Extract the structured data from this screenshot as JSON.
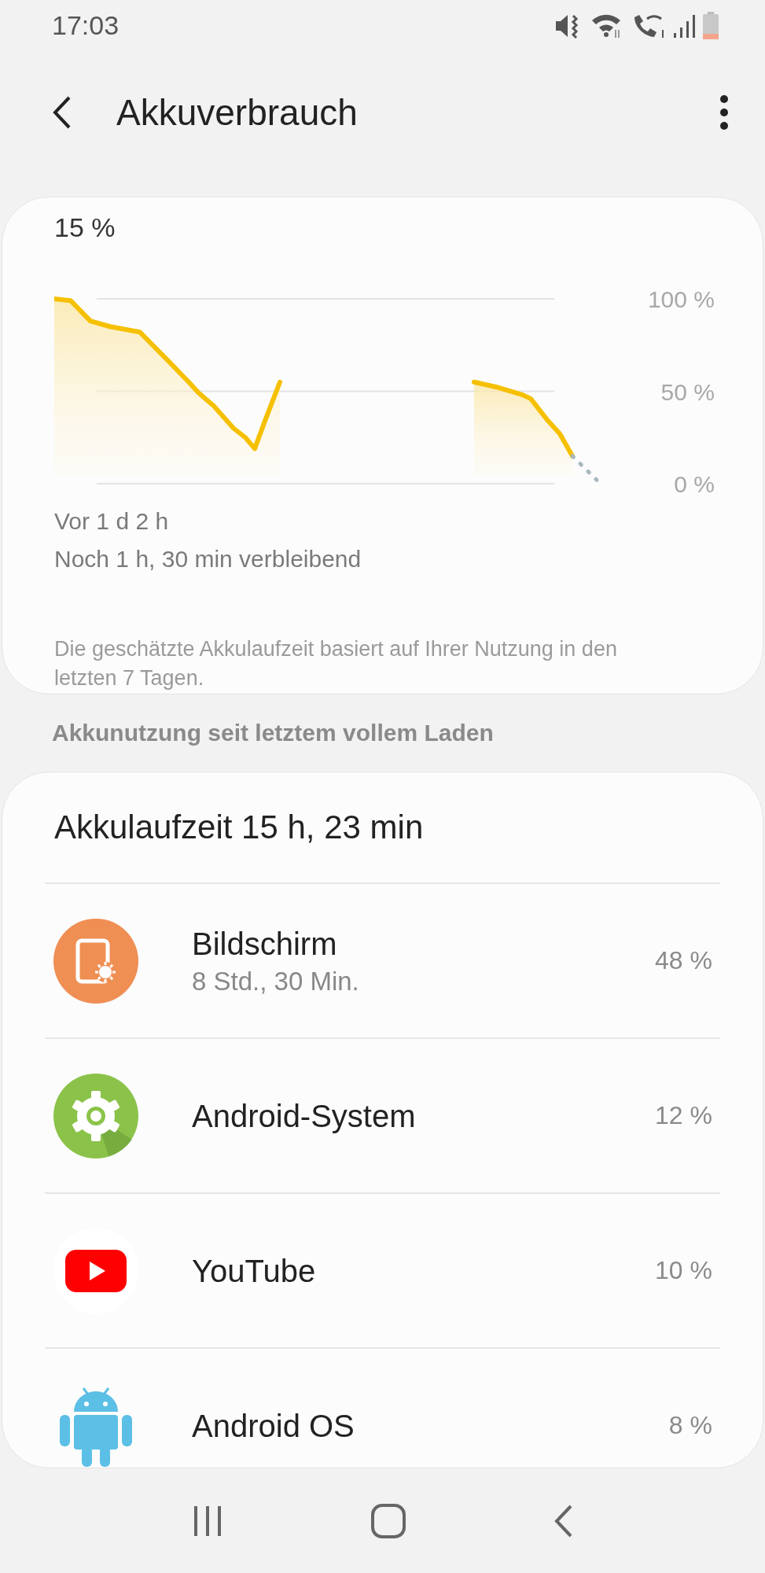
{
  "status_bar": {
    "time": "17:03"
  },
  "header": {
    "title": "Akkuverbrauch"
  },
  "battery_card": {
    "level_text": "15 %",
    "axis_labels": [
      "100 %",
      "50 %",
      "0 %"
    ],
    "start_label": "Vor 1 d 2 h",
    "remaining": "Noch 1 h, 30 min verbleibend",
    "note": "Die geschätzte Akkulaufzeit basiert auf Ihrer Nutzung in den letzten 7 Tagen."
  },
  "section_title": "Akkunutzung seit letztem vollem Laden",
  "usage_card": {
    "title": "Akkulaufzeit 15 h, 23 min",
    "apps": [
      {
        "kind": "screen",
        "name": "Bildschirm",
        "detail": "8 Std., 30 Min.",
        "percent": "48 %"
      },
      {
        "kind": "system",
        "name": "Android-System",
        "percent": "12 %"
      },
      {
        "kind": "youtube",
        "name": "YouTube",
        "percent": "10 %"
      },
      {
        "kind": "android",
        "name": "Android OS",
        "percent": "8 %"
      }
    ]
  }
}
